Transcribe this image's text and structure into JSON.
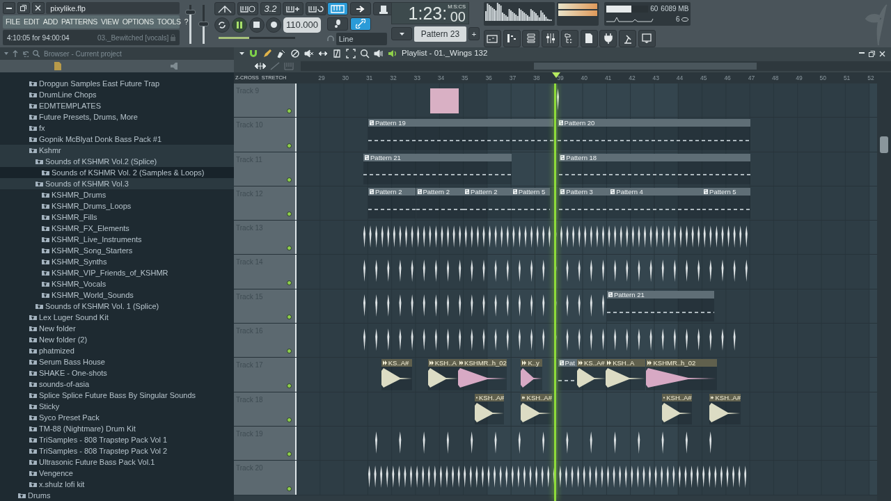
{
  "window": {
    "title": "pixylike.flp"
  },
  "menu": [
    "FILE",
    "EDIT",
    "ADD",
    "PATTERNS",
    "VIEW",
    "OPTIONS",
    "TOOLS",
    "?"
  ],
  "hint": {
    "time": "4:10:05 for 94:00:04",
    "item": "03._Bewitched [vocals]"
  },
  "master": {
    "volume": {
      "level": 0.85
    },
    "pitch": {
      "level": 0.5
    }
  },
  "transport": {
    "snap_text": "3.2",
    "playing": true,
    "recording": false,
    "tempo": "110.000",
    "position": {
      "level": 0.4
    }
  },
  "modes": {
    "pattern_mode": true,
    "link": true,
    "snap": "Line"
  },
  "clock": {
    "time": "1:23:",
    "centiseconds": "00",
    "unit": "M:S:CS"
  },
  "pattern_selector": {
    "value": "Pattern 23",
    "add": "+"
  },
  "monitor": {
    "cpu": "60",
    "cpu_level": {
      "level": 0.6
    },
    "memory": "6089 MB",
    "polyphony": "6"
  },
  "browser": {
    "title": "Browser - Current project",
    "items": [
      {
        "label": "Dropgun Samples East Future Trap"
      },
      {
        "label": "DrumLine Chops"
      },
      {
        "label": "EDMTEMPLATES"
      },
      {
        "label": "Future Presets, Drums, More"
      },
      {
        "label": "fx"
      },
      {
        "label": "Gopnik McBlyat Donk Bass Pack #1"
      },
      {
        "label": "Kshmr",
        "expanded": true,
        "children": [
          {
            "label": "Sounds of KSHMR Vol.2 (Splice)",
            "expanded": true,
            "children": [
              {
                "label": "Sounds of KSHMR Vol. 2 (Samples & Loops)",
                "selected": true
              }
            ]
          },
          {
            "label": "Sounds of KSHMR Vol.3",
            "expanded": true,
            "children": [
              {
                "label": "KSHMR_Drums"
              },
              {
                "label": "KSHMR_Drums_Loops"
              },
              {
                "label": "KSHMR_Fills"
              },
              {
                "label": "KSHMR_FX_Elements"
              },
              {
                "label": "KSHMR_Live_Instruments"
              },
              {
                "label": "KSHMR_Song_Starters"
              },
              {
                "label": "KSHMR_Synths"
              },
              {
                "label": "KSHMR_VIP_Friends_of_KSHMR"
              },
              {
                "label": "KSHMR_Vocals"
              },
              {
                "label": "KSHMR_World_Sounds"
              }
            ]
          },
          {
            "label": "Sounds of KSHMR Vol. 1 (Splice)"
          }
        ]
      },
      {
        "label": "Lex Luger Sound Kit"
      },
      {
        "label": "New folder"
      },
      {
        "label": "New folder (2)"
      },
      {
        "label": "phatmized"
      },
      {
        "label": "Serum Bass House"
      },
      {
        "label": "SHAKE - One-shots"
      },
      {
        "label": "sounds-of-asia"
      },
      {
        "label": "Splice Splice Future Bass By Singular Sounds"
      },
      {
        "label": "Sticky"
      },
      {
        "label": "Syco Preset Pack"
      },
      {
        "label": "TM-88 (Nightmare) Drum Kit"
      },
      {
        "label": "TriSamples - 808 Trapstep Pack Vol 1"
      },
      {
        "label": "TriSamples - 808 Trapstep Pack Vol 2"
      },
      {
        "label": "Ultrasonic Future Bass Pack Vol.1"
      },
      {
        "label": "Vengence"
      },
      {
        "label": "x.shulz lofi kit"
      }
    ],
    "outer_items": [
      {
        "label": "Drums"
      }
    ]
  },
  "playlist": {
    "title": "Playlist - 01._Wings 132",
    "ruler_modes": [
      "Z-CROSS",
      "STRETCH"
    ],
    "bars": [
      "29",
      "30",
      "31",
      "32",
      "33",
      "34",
      "35",
      "36",
      "37",
      "38",
      "39",
      "40",
      "41",
      "42",
      "43",
      "44",
      "45",
      "46",
      "47",
      "48",
      "49",
      "50",
      "51",
      "52"
    ],
    "tracks": [
      {
        "name": "Track 9",
        "on": true
      },
      {
        "name": "Track 10",
        "on": true,
        "clips": [
          {
            "kind": "pattern",
            "label": "Pattern 19"
          },
          {
            "kind": "pattern",
            "label": "Pattern 20"
          }
        ]
      },
      {
        "name": "Track 11",
        "on": true,
        "clips": [
          {
            "kind": "pattern",
            "label": "Pattern 21"
          },
          {
            "kind": "pattern",
            "label": "Pattern 18"
          }
        ]
      },
      {
        "name": "Track 12",
        "on": true,
        "clips": [
          {
            "kind": "pattern",
            "label": "Pattern 2"
          },
          {
            "kind": "pattern",
            "label": "Pattern 2"
          },
          {
            "kind": "pattern",
            "label": "Pattern 2"
          },
          {
            "kind": "pattern",
            "label": "Pattern 5"
          },
          {
            "kind": "pattern",
            "label": "Pattern 3"
          },
          {
            "kind": "pattern",
            "label": "Pattern 4"
          },
          {
            "kind": "pattern",
            "label": "Pattern 5"
          }
        ]
      },
      {
        "name": "Track 13",
        "on": true
      },
      {
        "name": "Track 14",
        "on": true
      },
      {
        "name": "Track 15",
        "on": true,
        "clips": [
          {
            "kind": "pattern",
            "label": "Pattern 21"
          }
        ]
      },
      {
        "name": "Track 16",
        "on": true
      },
      {
        "name": "Track 17",
        "on": true,
        "clips": [
          {
            "kind": "audio",
            "label": "KS..A#",
            "color": "#dcdcc4"
          },
          {
            "kind": "audio",
            "label": "KSH..A",
            "color": "#dcdcc4"
          },
          {
            "kind": "audio",
            "label": "KSHMR..h_02",
            "color": "#d7a9c4"
          },
          {
            "kind": "audio",
            "label": "K..y",
            "color": "#d7a9c4"
          },
          {
            "kind": "pattern",
            "label": "Pat"
          },
          {
            "kind": "audio",
            "label": "KS..A#",
            "color": "#dcdcc4"
          },
          {
            "kind": "audio",
            "label": "KSH..A",
            "color": "#dcdcc4"
          },
          {
            "kind": "audio",
            "label": "KSHMR..h_02",
            "color": "#d7a9c4"
          }
        ]
      },
      {
        "name": "Track 18",
        "on": true,
        "clips": [
          {
            "kind": "audio",
            "label": "KSH..A#",
            "color": "#dcdcc4"
          },
          {
            "kind": "audio",
            "label": "KSH..A#",
            "color": "#dcdcc4"
          },
          {
            "kind": "audio",
            "label": "KSH..A#",
            "color": "#dcdcc4"
          },
          {
            "kind": "audio",
            "label": "KSH..A#",
            "color": "#dcdcc4"
          }
        ]
      },
      {
        "name": "Track 19",
        "on": true
      },
      {
        "name": "Track 20",
        "on": true
      }
    ]
  }
}
